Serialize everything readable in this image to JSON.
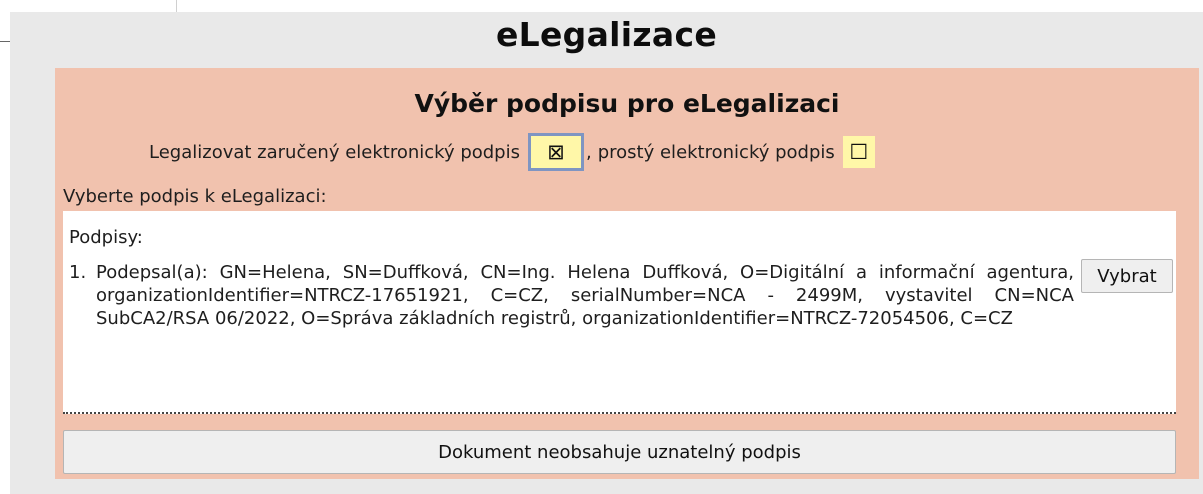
{
  "app": {
    "title": "eLegalizace"
  },
  "panel": {
    "heading": "Výběr podpisu pro eLegalizaci",
    "qualified_label": "Legalizovat zaručený elektronický podpis",
    "qualified_checked": true,
    "qualified_mark": "⊠",
    "separator": ",",
    "simple_label": "prostý elektronický podpis",
    "simple_checked": false,
    "simple_mark": "☐",
    "select_label": "Vyberte podpis k eLegalizaci:"
  },
  "signatures": {
    "heading": "Podpisy:",
    "items": [
      {
        "number": "1.",
        "text": "Podepsal(a): GN=Helena, SN=Duffková, CN=Ing. Helena Duffková, O=Digitální a informační agentura, organizationIdentifier=NTRCZ-17651921, C=CZ, serialNumber=NCA - 2499M, vystavitel CN=NCA SubCA2/RSA 06/2022, O=Správa základních registrů, organizationIdentifier=NTRCZ-72054506, C=CZ",
        "select_label": "Vybrat"
      }
    ]
  },
  "footer": {
    "no_signature_label": "Dokument neobsahuje uznatelný podpis"
  },
  "colors": {
    "app_background": "#e9e9e9",
    "panel_background": "#f1c2ae",
    "checkbox_background": "#fff7a8",
    "focus_border": "#7f95c2"
  }
}
